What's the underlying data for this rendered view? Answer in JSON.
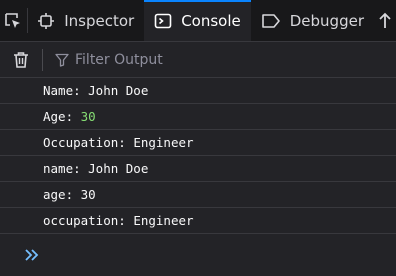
{
  "tabs": [
    {
      "label": "Inspector",
      "icon": "inspector-icon"
    },
    {
      "label": "Console",
      "icon": "console-icon",
      "active": true
    },
    {
      "label": "Debugger",
      "icon": "debugger-icon"
    }
  ],
  "toolbar": {
    "filter_placeholder": "Filter Output"
  },
  "messages": [
    {
      "key": "Name: ",
      "value": "John Doe",
      "type": "string"
    },
    {
      "key": "Age: ",
      "value": "30",
      "type": "number"
    },
    {
      "key": "Occupation: ",
      "value": "Engineer",
      "type": "string"
    },
    {
      "key": "name: ",
      "value": "John Doe",
      "type": "string"
    },
    {
      "key": "age: ",
      "value": "30",
      "type": "string"
    },
    {
      "key": "occupation: ",
      "value": "Engineer",
      "type": "string"
    }
  ],
  "colors": {
    "accent": "#0a84ff",
    "number": "#86de74",
    "prompt": "#75bfff"
  }
}
